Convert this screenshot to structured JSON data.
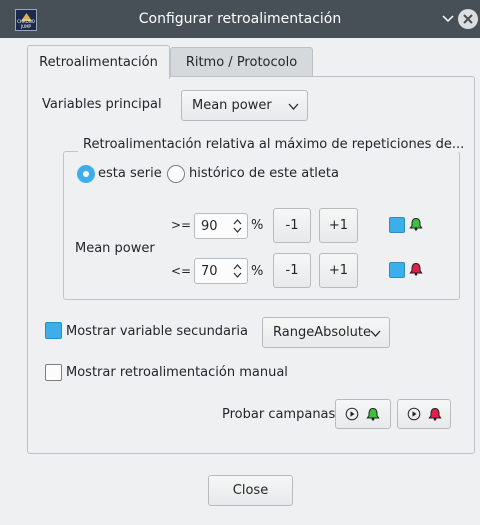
{
  "window": {
    "title": "Configurar retroalimentación",
    "logo_text": "CHRONO JUMP"
  },
  "tabs": [
    {
      "label": "Retroalimentación",
      "active": true
    },
    {
      "label": "Ritmo / Protocolo",
      "active": false
    }
  ],
  "main_variable": {
    "label": "Variables principal",
    "selected": "Mean power"
  },
  "relative_group": {
    "title": "Retroalimentación relativa al máximo de repeticiones de...",
    "options": [
      {
        "label": "esta serie",
        "selected": true
      },
      {
        "label": "histórico de este atleta",
        "selected": false
      }
    ],
    "variable_label": "Mean power",
    "rows": [
      {
        "operator": ">=",
        "value": "90",
        "unit": "%",
        "minus_label": "-1",
        "plus_label": "+1",
        "bell_color": "#3fbf3f",
        "checked": true
      },
      {
        "operator": "<=",
        "value": "70",
        "unit": "%",
        "minus_label": "-1",
        "plus_label": "+1",
        "bell_color": "#e0204a",
        "checked": true
      }
    ]
  },
  "secondary": {
    "label": "Mostrar variable secundaria",
    "checked": true,
    "selected": "RangeAbsolute"
  },
  "manual": {
    "label": "Mostrar retroalimentación manual",
    "checked": false
  },
  "test_bells": {
    "label": "Probar campanas",
    "good_bell_color": "#3fbf3f",
    "bad_bell_color": "#e0204a"
  },
  "footer": {
    "close_label": "Close"
  },
  "colors": {
    "titlebar": "#475057",
    "accent": "#3daee9",
    "background": "#eff0f1"
  }
}
